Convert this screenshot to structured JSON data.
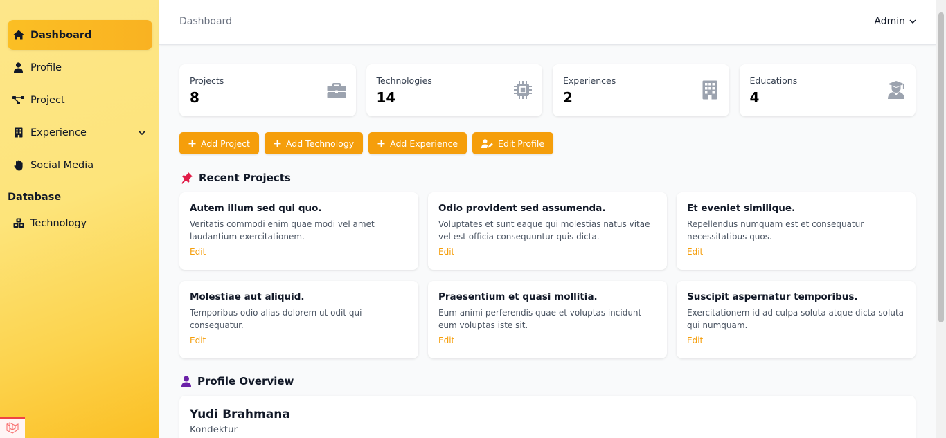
{
  "sidebar": {
    "items": [
      {
        "label": "Dashboard",
        "icon": "home-icon",
        "active": true
      },
      {
        "label": "Profile",
        "icon": "user-icon"
      },
      {
        "label": "Project",
        "icon": "project-diagram-icon"
      },
      {
        "label": "Experience",
        "icon": "building-icon",
        "has_submenu": true
      },
      {
        "label": "Social Media",
        "icon": "hand-icon"
      }
    ],
    "section_title": "Database",
    "database_items": [
      {
        "label": "Technology",
        "icon": "cubes-icon"
      }
    ]
  },
  "header": {
    "breadcrumb": "Dashboard",
    "user_label": "Admin"
  },
  "stats": [
    {
      "label": "Projects",
      "value": "8",
      "icon": "briefcase-icon"
    },
    {
      "label": "Technologies",
      "value": "14",
      "icon": "microchip-icon"
    },
    {
      "label": "Experiences",
      "value": "2",
      "icon": "building-icon"
    },
    {
      "label": "Educations",
      "value": "4",
      "icon": "graduate-icon"
    }
  ],
  "actions": [
    {
      "label": "Add Project",
      "icon": "plus-icon"
    },
    {
      "label": "Add Technology",
      "icon": "plus-icon"
    },
    {
      "label": "Add Experience",
      "icon": "plus-icon"
    },
    {
      "label": "Edit Profile",
      "icon": "user-edit-icon"
    }
  ],
  "recent_projects": {
    "title": "Recent Projects",
    "edit_label": "Edit",
    "items": [
      {
        "title": "Autem illum sed qui quo.",
        "description": "Veritatis commodi enim quae modi vel amet laudantium exercitationem."
      },
      {
        "title": "Odio provident sed assumenda.",
        "description": "Voluptates et sunt eaque qui molestias natus vitae vel est officia consequuntur quis dicta."
      },
      {
        "title": "Et eveniet similique.",
        "description": "Repellendus numquam est et consequatur necessitatibus quos."
      },
      {
        "title": "Molestiae aut aliquid.",
        "description": "Temporibus odio alias dolorem ut odit qui consequatur."
      },
      {
        "title": "Praesentium et quasi mollitia.",
        "description": "Eum animi perferendis quae et voluptas incidunt eum voluptas iste sit."
      },
      {
        "title": "Suscipit aspernatur temporibus.",
        "description": "Exercitationem id ad culpa soluta atque dicta soluta qui numquam."
      }
    ]
  },
  "profile_overview": {
    "title": "Profile Overview",
    "name": "Yudi Brahmana",
    "role": "Kondektur"
  },
  "colors": {
    "accent": "#f59e0b",
    "sidebar_top": "#fde68a",
    "sidebar_bottom": "#fbbf24",
    "active_item": "#fbbf24",
    "stat_icon": "#9ca3af"
  }
}
